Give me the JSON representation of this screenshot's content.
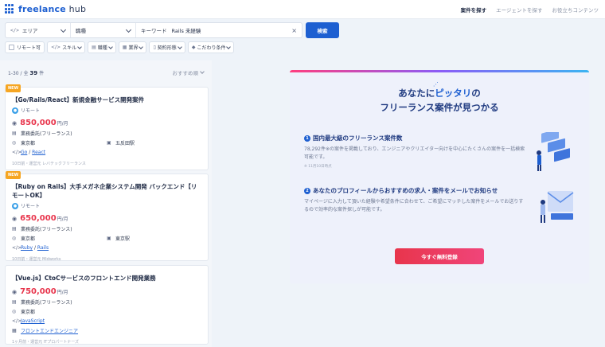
{
  "header": {
    "logo_bold": "freelance",
    "logo_light": " hub",
    "nav": [
      "案件を探す",
      "エージェントを探す",
      "お役立ちコンテンツ"
    ]
  },
  "search": {
    "area_label": "エリア",
    "job_label": "職種",
    "keyword_label": "キーワード",
    "keyword_value": "Rails 未経験",
    "button": "検索"
  },
  "filters": {
    "remote": "リモート可",
    "skill": "スキル",
    "role": "職種",
    "industry": "業界",
    "contract": "契約形態",
    "special": "こだわり条件"
  },
  "list": {
    "count_prefix": "1-30 / 全",
    "count_value": "39",
    "count_suffix": "件",
    "sort": "おすすめ順",
    "jobs": [
      {
        "badge": "NEW",
        "title": "【Go/Rails/React】新規金融サービス開発案件",
        "remote": "リモート",
        "price": "850,000",
        "unit": "円/月",
        "contract": "業務委託(フリーランス)",
        "location": "東京都",
        "station": "五反田駅",
        "skills_a": "Go",
        "skills_b": "React",
        "footer": "10日前・運営元 レバテックフリーランス"
      },
      {
        "badge": "NEW",
        "title": "【Ruby on Rails】大手メガネ企業システム開発 バックエンド【リモートOK】",
        "remote": "リモート",
        "price": "650,000",
        "unit": "円/月",
        "contract": "業務委託(フリーランス)",
        "location": "東京都",
        "station": "東京駅",
        "skills_a": "Ruby",
        "skills_b": "Rails",
        "footer": "10日前・運営元 Midworks"
      },
      {
        "title": "【Vue.js】CtoCサービスのフロントエンド開発業務",
        "price": "750,000",
        "unit": "円/月",
        "contract": "業務委託(フリーランス)",
        "location": "東京都",
        "skills_a": "JavaScript",
        "role": "フロントエンドエンジニア",
        "footer": "1ヶ月前・運営元 ITプロパートナーズ"
      }
    ]
  },
  "promo": {
    "line1_a": "あなたに",
    "line1_b": "ピッタリ",
    "line1_c": "の",
    "line2": "フリーランス案件が見つかる",
    "f1_num": "1",
    "f1_title": "国内最大級のフリーランス案件数",
    "f1_desc": "78,292件※の案件を掲載しており、エンジニアやクリエイター向けを中心にたくさんの案件を一括検索可能です。",
    "f1_note": "※ 11月10日時点",
    "f2_num": "2",
    "f2_title": "あなたのプロフィールからおすすめの求人・案件をメールでお知らせ",
    "f2_desc": "マイページに入力して頂いた経験や希望条件に合わせて、ご希望にマッチした案件をメールでお送りするので効率的な案件探しが可能です。",
    "cta": "今すぐ無料登録"
  },
  "colors": {
    "brand": "#1d5fd1",
    "price": "#e8354c",
    "badge": "#f6a623"
  }
}
